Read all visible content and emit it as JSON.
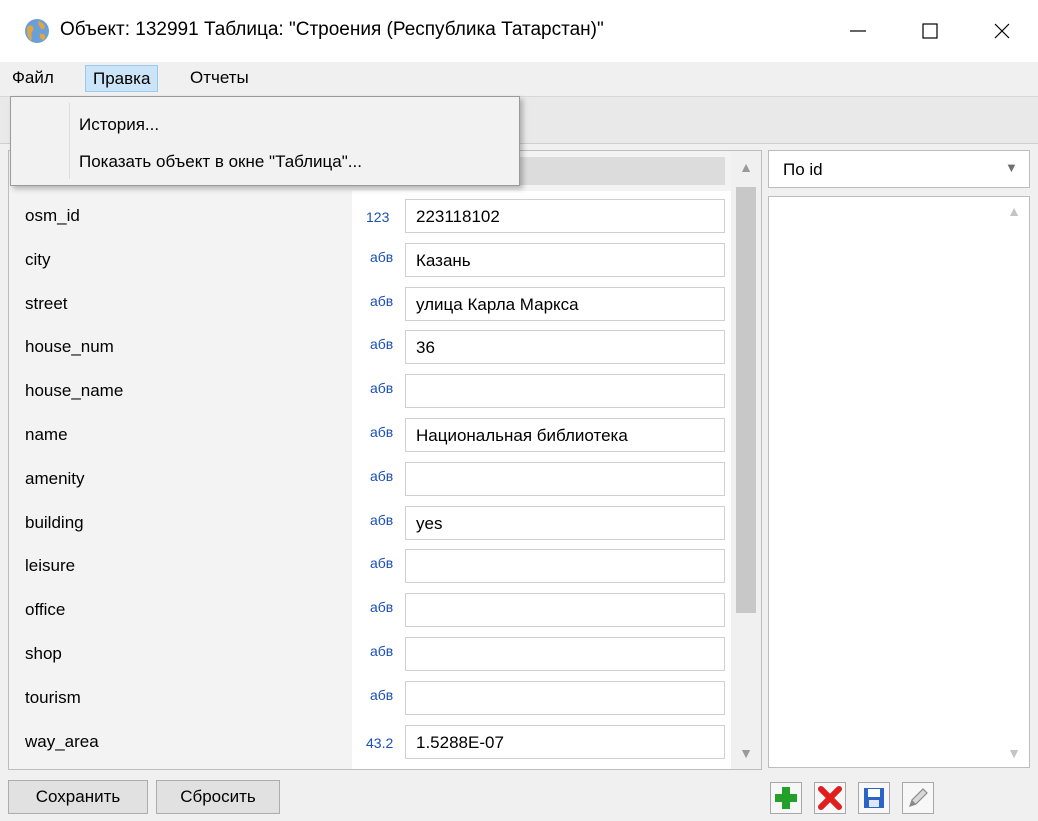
{
  "window": {
    "title": "Объект: 132991 Таблица: \"Строения (Республика Татарстан)\""
  },
  "menu": {
    "file": "Файл",
    "edit": "Правка",
    "reports": "Отчеты"
  },
  "dropdown": {
    "history": "История...",
    "show_in_table": "Показать объект в окне \"Таблица\"..."
  },
  "fields": [
    {
      "name": "osm_id",
      "type": "123",
      "value": "223118102"
    },
    {
      "name": "city",
      "type": "абв",
      "value": "Казань"
    },
    {
      "name": "street",
      "type": "абв",
      "value": "улица Карла Маркса"
    },
    {
      "name": "house_num",
      "type": "абв",
      "value": "36"
    },
    {
      "name": "house_name",
      "type": "абв",
      "value": ""
    },
    {
      "name": "name",
      "type": "абв",
      "value": "Национальная библиотека"
    },
    {
      "name": "amenity",
      "type": "абв",
      "value": ""
    },
    {
      "name": "building",
      "type": "абв",
      "value": "yes"
    },
    {
      "name": "leisure",
      "type": "абв",
      "value": ""
    },
    {
      "name": "office",
      "type": "абв",
      "value": ""
    },
    {
      "name": "shop",
      "type": "абв",
      "value": ""
    },
    {
      "name": "tourism",
      "type": "абв",
      "value": ""
    },
    {
      "name": "way_area",
      "type": "43.2",
      "value": "1.5288E-07"
    }
  ],
  "right_panel": {
    "sort_value": "По id"
  },
  "buttons": {
    "save": "Сохранить",
    "reset": "Сбросить"
  },
  "icons": {
    "app": "globe-icon",
    "add": "plus-icon",
    "delete": "x-icon",
    "save": "floppy-icon",
    "edit": "pencil-icon"
  },
  "colors": {
    "type_icon": "#1a4fb5",
    "menu_highlight": "#cce4f7",
    "add_green": "#22a02a",
    "delete_red": "#e01e1e",
    "floppy_blue": "#2b63c6"
  }
}
